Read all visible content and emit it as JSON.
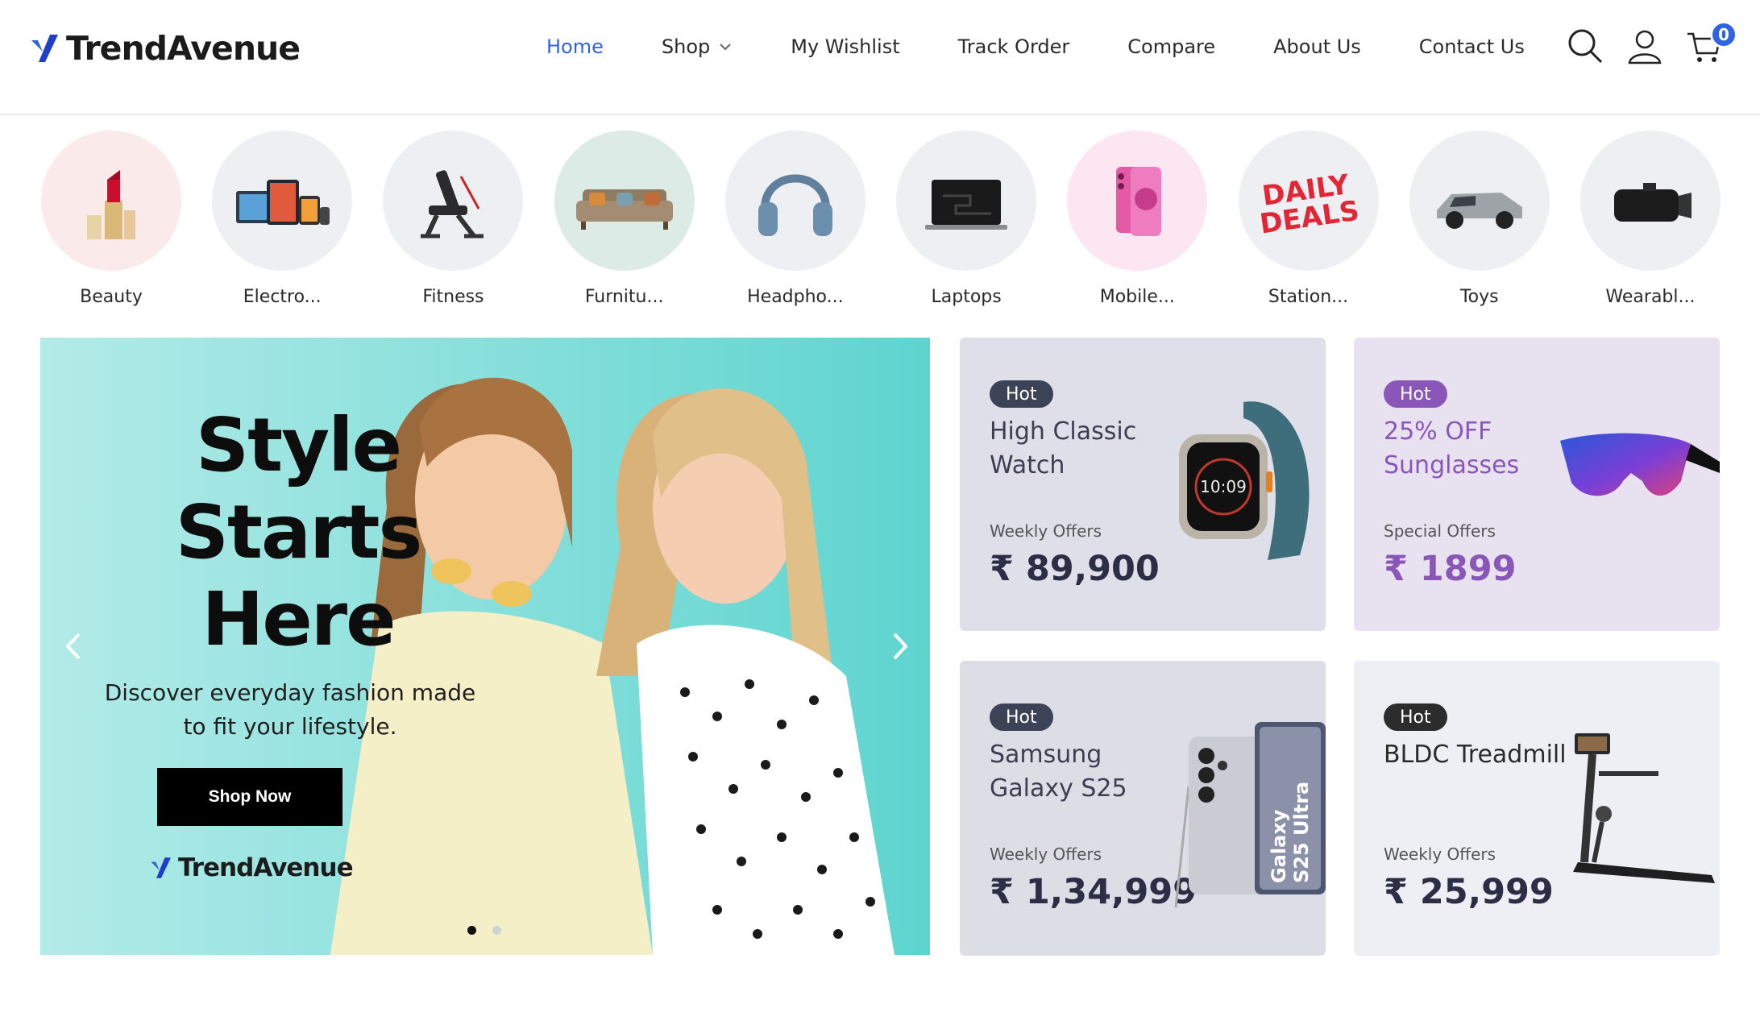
{
  "brand": {
    "name": "TrendAvenue",
    "accent": "#2f63e6"
  },
  "nav": {
    "items": [
      {
        "label": "Home",
        "active": true
      },
      {
        "label": "Shop",
        "dropdown": true
      },
      {
        "label": "My Wishlist"
      },
      {
        "label": "Track Order"
      },
      {
        "label": "Compare"
      },
      {
        "label": "About Us"
      },
      {
        "label": "Contact Us"
      }
    ]
  },
  "header_icons": {
    "search": "search-icon",
    "account": "user-icon",
    "cart": "cart-icon",
    "cart_count": "0"
  },
  "categories": [
    {
      "label": "Beauty",
      "icon": "lipstick-icon"
    },
    {
      "label": "Electro...",
      "icon": "devices-icon"
    },
    {
      "label": "Fitness",
      "icon": "workout-bench-icon"
    },
    {
      "label": "Furnitu...",
      "icon": "sofa-icon"
    },
    {
      "label": "Headpho...",
      "icon": "headphones-icon"
    },
    {
      "label": "Laptops",
      "icon": "laptop-icon"
    },
    {
      "label": "Mobile...",
      "icon": "smartphone-icon"
    },
    {
      "label": "Station...",
      "icon": "daily-deals-icon",
      "art_text": "DAILY DEALS"
    },
    {
      "label": "Toys",
      "icon": "toy-car-icon"
    },
    {
      "label": "Wearabl...",
      "icon": "vr-headset-icon"
    }
  ],
  "hero": {
    "title_lines": [
      "Style",
      "Starts",
      "Here"
    ],
    "subtitle": "Discover everyday fashion made to fit your lifestyle.",
    "cta": "Shop Now",
    "brand": "TrendAvenue",
    "slides": 2,
    "active_slide": 1
  },
  "promos": [
    {
      "tag": "Hot",
      "title": "High Classic Watch",
      "sub": "Weekly Offers",
      "price": "₹ 89,900",
      "tag_color": "#3d4356",
      "title_color": "#3c3f52",
      "price_color": "#2b2e44",
      "icon": "smartwatch-icon"
    },
    {
      "tag": "Hot",
      "title": "25% OFF Sunglasses",
      "sub": "Special Offers",
      "price": "₹ 1899",
      "tag_color": "#8a57b8",
      "title_color": "#8a57b8",
      "price_color": "#8a57b8",
      "icon": "sunglasses-icon"
    },
    {
      "tag": "Hot",
      "title": "Samsung Galaxy S25",
      "sub": "Weekly Offers",
      "price": "₹ 1,34,999",
      "tag_color": "#3d4356",
      "title_color": "#3c3f52",
      "price_color": "#2b2e44",
      "icon": "phone-icon",
      "art_text": "Galaxy S25 Ultra"
    },
    {
      "tag": "Hot",
      "title": "BLDC Treadmill",
      "sub": "Weekly Offers",
      "price": "₹ 25,999",
      "tag_color": "#2c2c2c",
      "title_color": "#2b2b2b",
      "price_color": "#2b2e44",
      "icon": "treadmill-icon"
    }
  ]
}
